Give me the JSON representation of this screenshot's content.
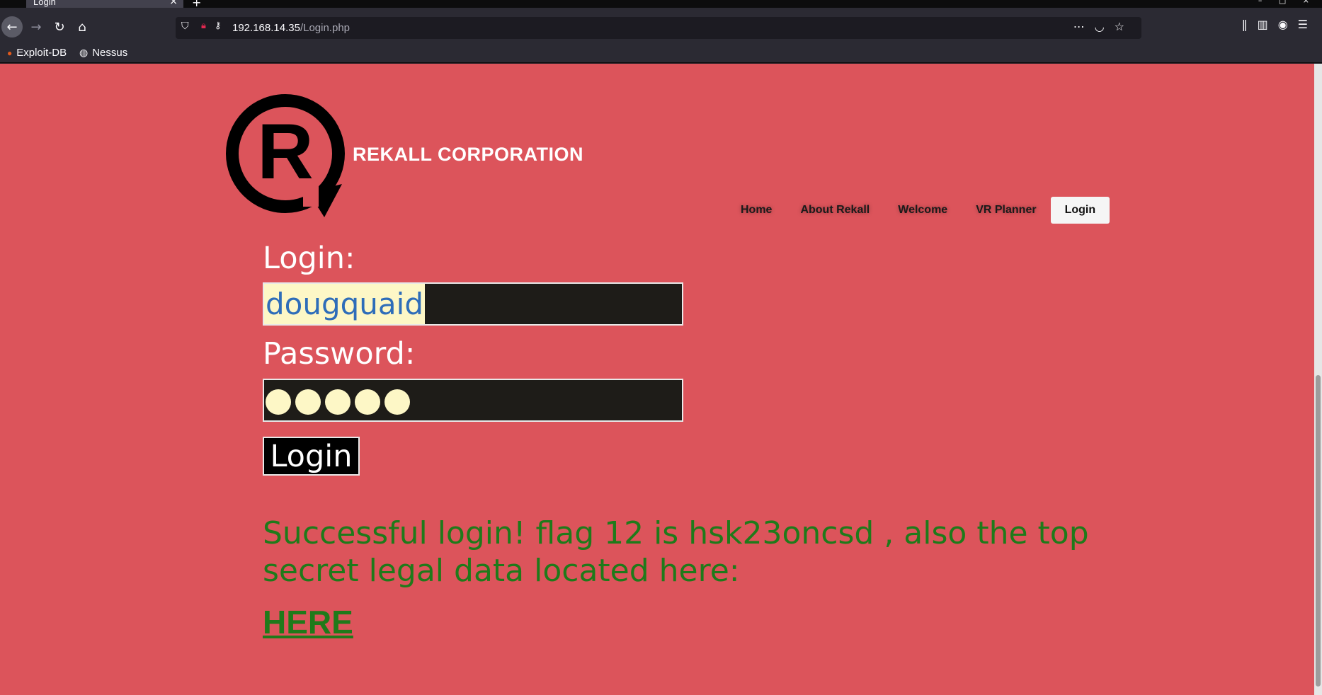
{
  "browser": {
    "tab_title": "Login",
    "tab_close": "×",
    "new_tab": "+",
    "window_controls": "– □ ×",
    "url_host": "192.168.14.35",
    "url_path": "/Login.php",
    "bookmarks": [
      "Exploit-DB",
      "Nessus"
    ]
  },
  "site": {
    "brand": "REKALL CORPORATION",
    "nav": [
      "Home",
      "About Rekall",
      "Welcome",
      "VR Planner",
      "Login"
    ],
    "active_nav": "Login"
  },
  "form": {
    "login_label": "Login:",
    "username_value": "dougquaid",
    "password_label": "Password:",
    "password_mask_count": 5,
    "submit_label": "Login"
  },
  "result": {
    "message": "Successful login! flag 12 is hsk23oncsd , also the top secret legal data located here:",
    "link_label": "HERE"
  },
  "colors": {
    "page_background": "#dc545b",
    "success_text": "#1f7a1a",
    "input_background": "#1e1c18",
    "autofill_highlight": "#fdf7c6"
  }
}
